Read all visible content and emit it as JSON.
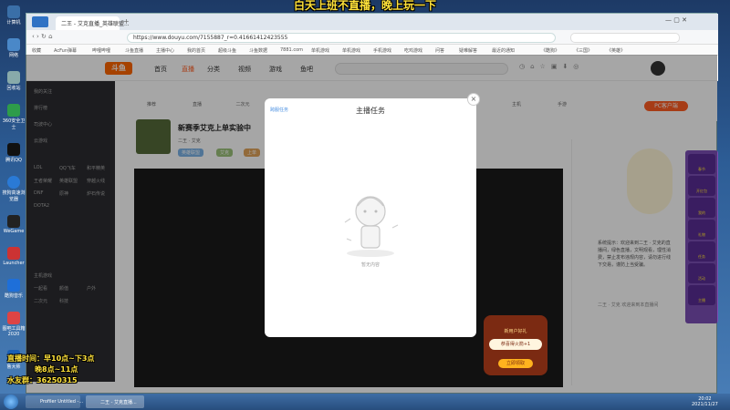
{
  "overlay": {
    "banner": "白天上班不直播，晚上玩一下",
    "schedule_line1": "直播时间：早10点~下3点",
    "schedule_line2": "晚8点~11点",
    "qq_group": "水友群：36250315"
  },
  "desktop_icons": [
    "计算机",
    "网络",
    "回收站",
    "360安全卫士",
    "腾讯QQ",
    "搜狗高速浏览器",
    "WeGame",
    "Launcher",
    "酷狗音乐",
    "图吧工具箱2020",
    "鲁大师"
  ],
  "browser": {
    "tabs": [
      "二王 - 艾克直播_英雄联盟..."
    ],
    "url": "https://www.douyu.com/7155887_r=0.41661412423555",
    "bookmarks": [
      "收藏",
      "AcFun弹幕",
      "哔哩哔哩",
      "斗鱼直播",
      "主播中心",
      "我的首页",
      "超级斗鱼",
      "斗鱼数据",
      "7881.com",
      "单机游戏",
      "单机游戏",
      "手机游戏",
      "吃鸡游戏",
      "问答",
      "疑难解答",
      "最近的通知",
      "《酷狗》",
      "《三国》",
      "《英雄》"
    ]
  },
  "site": {
    "logo": "斗鱼",
    "nav": [
      "首页",
      "直播",
      "分类",
      "视频",
      "游戏",
      "鱼吧"
    ],
    "pc_client": "PC客户端"
  },
  "sidebar": {
    "items": [
      "我的关注",
      "排行榜",
      "司波中心",
      "云游戏",
      "LOL",
      "QQ飞车",
      "和平精英",
      "王者荣耀",
      "英雄联盟",
      "穿越火线",
      "DNF",
      "原神",
      "炉石传说",
      "DOTA2",
      "主机游戏",
      "一起看",
      "颜值",
      "户外",
      "二次元",
      "科技"
    ]
  },
  "categories": [
    "推荐",
    "直播",
    "二次元",
    "舞蹈",
    "音乐",
    "颜值",
    "聊天",
    "户外",
    "主机",
    "手游"
  ],
  "room": {
    "title": "新赛季艾克上单实验中",
    "streamer": "二王 · 艾克",
    "tags": [
      "英雄联盟",
      "艾克",
      "上单"
    ]
  },
  "chat": {
    "text": "系统提示：欢迎来到二王 · 艾克的直播间，绿色直播，文明观看，理性消费，禁止发布违规内容，请勿进行线下交易，谨防上当受骗。",
    "welcome": "二王 · 艾克 欢迎来到本直播间"
  },
  "right_rail": [
    "春节",
    "开红包",
    "我的",
    "礼物",
    "任务",
    "活动",
    "主播",
    "特权"
  ],
  "modal": {
    "title": "主播任务",
    "tab": "跨服任务",
    "empty_text": "暂无内容",
    "close": "×"
  },
  "gift": {
    "title": "新用户好礼",
    "amount": "恭喜得火箭+1",
    "button": "立即领取"
  },
  "taskbar": {
    "items": [
      "Profiler Untitled -...",
      "二王 - 艾克直播..."
    ],
    "time": "20:02",
    "date": "2021/11/27"
  },
  "colors": {
    "accent": "#ff5d23",
    "sidebar_bg": "#2b2c30",
    "overlay_yellow": "#ffe23a"
  }
}
